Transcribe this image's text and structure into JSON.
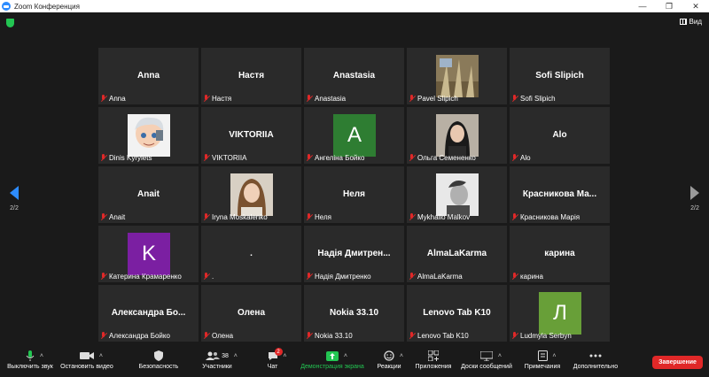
{
  "window": {
    "title": "Zoom Конференция"
  },
  "topbar": {
    "view_label": "Вид"
  },
  "pager": {
    "left_page": "2/2",
    "right_page": "2/2"
  },
  "tiles": [
    {
      "big": "Anna",
      "label": "Anna"
    },
    {
      "big": "Настя",
      "label": "Настя"
    },
    {
      "big": "Anastasia",
      "label": "Anastasia"
    },
    {
      "big": "",
      "label": "Pavel Slipich"
    },
    {
      "big": "Sofi Slipich",
      "label": "Sofi Slipich"
    },
    {
      "big": "",
      "label": "Dinis Kyrylets"
    },
    {
      "big": "VIKTORIIA",
      "label": "VIKTORIIA"
    },
    {
      "big": "",
      "label": "Ангеліна Бойко",
      "avatar_letter": "А",
      "avatar_color": "#2e7d32"
    },
    {
      "big": "",
      "label": "Ольга Семененко"
    },
    {
      "big": "Alo",
      "label": "Alo"
    },
    {
      "big": "Anait",
      "label": "Anait"
    },
    {
      "big": "",
      "label": "Iryna Moskalenko"
    },
    {
      "big": "Неля",
      "label": "Неля"
    },
    {
      "big": "",
      "label": "Mykhailo Malkov"
    },
    {
      "big": "Красникова Ма...",
      "label": "Красникова Марія"
    },
    {
      "big": "",
      "label": "Катерина Крамаренко",
      "avatar_letter": "K",
      "avatar_color": "#7b1fa2"
    },
    {
      "big": ".",
      "label": "."
    },
    {
      "big": "Надія Дмитрен...",
      "label": "Надія Дмитренко"
    },
    {
      "big": "AlmaLaKarma",
      "label": "AlmaLaKarma"
    },
    {
      "big": "карина",
      "label": "карина"
    },
    {
      "big": "Александра Бо...",
      "label": "Александра Бойко"
    },
    {
      "big": "Олена",
      "label": "Олена"
    },
    {
      "big": "Nokia 33.10",
      "label": "Nokia 33.10"
    },
    {
      "big": "Lenovo Tab K10",
      "label": "Lenovo Tab K10"
    },
    {
      "big": "",
      "label": "Ludmyla Serbyn",
      "avatar_letter": "Л",
      "avatar_color": "#689f38"
    }
  ],
  "toolbar": {
    "mute": "Выключить звук",
    "video": "Остановить видео",
    "security": "Безопасность",
    "participants": "Участники",
    "participants_count": "38",
    "chat": "Чат",
    "chat_badge": "2",
    "share": "Демонстрация экрана",
    "reactions": "Реакции",
    "apps": "Приложения",
    "whiteboards": "Доски сообщений",
    "notes": "Примечания",
    "more": "Дополнительно",
    "end": "Завершение"
  }
}
